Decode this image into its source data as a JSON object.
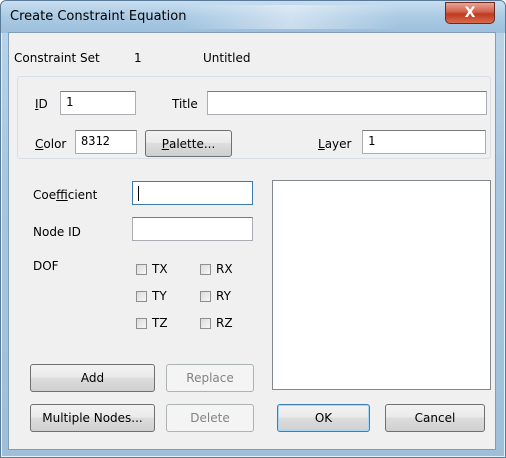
{
  "window": {
    "title": "Create Constraint Equation",
    "close_glyph": "X"
  },
  "header": {
    "set_label": "Constraint Set",
    "set_number": "1",
    "set_name": "Untitled"
  },
  "group": {
    "id_label_ul": "I",
    "id_label_rest": "D",
    "id_value": "1",
    "title_label": "Title",
    "title_value": "",
    "color_label_ul": "C",
    "color_label_rest": "olor",
    "color_value": "8312",
    "palette_ul": "P",
    "palette_rest": "alette...",
    "layer_label_ul": "L",
    "layer_label_rest": "ayer",
    "layer_value": "1"
  },
  "entry": {
    "coefficient_label_pre": "Coe",
    "coefficient_label_ul": "f",
    "coefficient_label_post": "ficient",
    "coefficient_value": "",
    "node_id_label": "Node ID",
    "node_id_value": "",
    "dof_label": "DOF"
  },
  "dof": [
    {
      "label": "TX",
      "checked": false
    },
    {
      "label": "RX",
      "checked": false
    },
    {
      "label": "TY",
      "checked": false
    },
    {
      "label": "RY",
      "checked": false
    },
    {
      "label": "TZ",
      "checked": false
    },
    {
      "label": "RZ",
      "checked": false
    }
  ],
  "buttons": {
    "add": "Add",
    "replace": "Replace",
    "multiple_nodes": "Multiple Nodes...",
    "delete": "Delete",
    "ok": "OK",
    "cancel": "Cancel"
  }
}
